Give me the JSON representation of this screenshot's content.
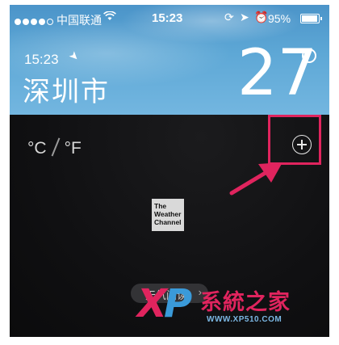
{
  "status_bar": {
    "carrier": "中国联通",
    "time": "15:23",
    "battery_percent": "95%",
    "signal_bars_filled": 4,
    "signal_bars_total": 5,
    "icons": [
      "signal-dots-icon",
      "wifi-icon",
      "rotation-lock-icon",
      "location-arrow-icon",
      "alarm-icon",
      "battery-icon"
    ]
  },
  "weather": {
    "local_time": "15:23",
    "city": "深圳市",
    "temperature": "27"
  },
  "controls": {
    "celsius": "°C",
    "fahrenheit": "°F",
    "add_icon": "plus-circle-icon"
  },
  "logo": {
    "line1": "The",
    "line2": "Weather",
    "line3": "Channel"
  },
  "bottom_button": {
    "label": "天气阅读"
  },
  "watermark": {
    "x": "X",
    "p": "P",
    "name": "系統之家",
    "url": "WWW.XP510.COM"
  },
  "colors": {
    "highlight": "#e0245e",
    "sky": "#5ea8d6",
    "background": "#101012"
  }
}
